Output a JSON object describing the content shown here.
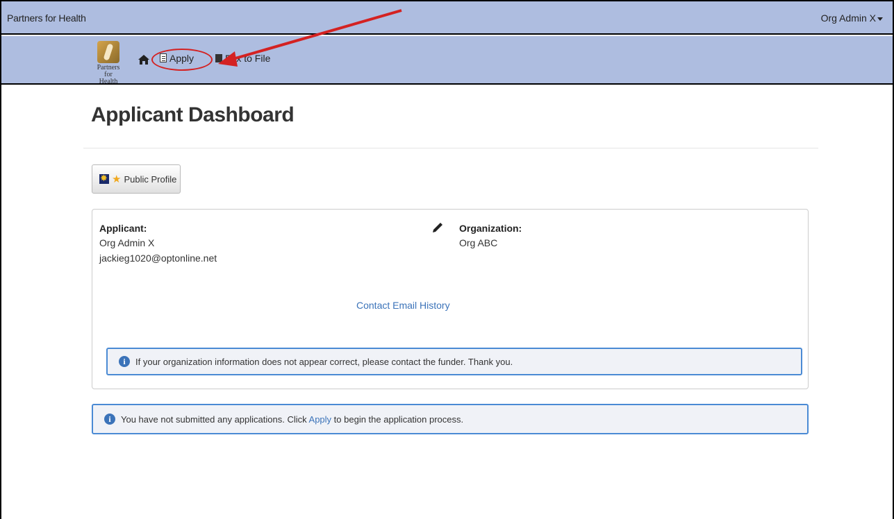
{
  "topbar": {
    "brand": "Partners for Health",
    "user_menu": "Org Admin X"
  },
  "navbar": {
    "logo_text_line1": "Partners",
    "logo_text_line2": "for Health",
    "home_icon": "home-icon",
    "apply_label": "Apply",
    "fax_label": "Fax to File"
  },
  "page": {
    "title": "Applicant Dashboard",
    "public_profile_label": "Public Profile"
  },
  "panel": {
    "applicant_label": "Applicant:",
    "applicant_name": "Org Admin X",
    "applicant_email": "jackieg1020@optonline.net",
    "organization_label": "Organization:",
    "organization_name": "Org ABC",
    "contact_history_link": "Contact Email History",
    "org_notice": "If your organization information does not appear correct, please contact the funder. Thank you."
  },
  "notice": {
    "text_before": "You have not submitted any applications. Click ",
    "link": "Apply",
    "text_after": " to begin the application process."
  },
  "colors": {
    "nav_bg": "#aebde0",
    "link": "#3b73b9",
    "alert_border": "#4a8ad4",
    "annotation_red": "#d42222"
  }
}
